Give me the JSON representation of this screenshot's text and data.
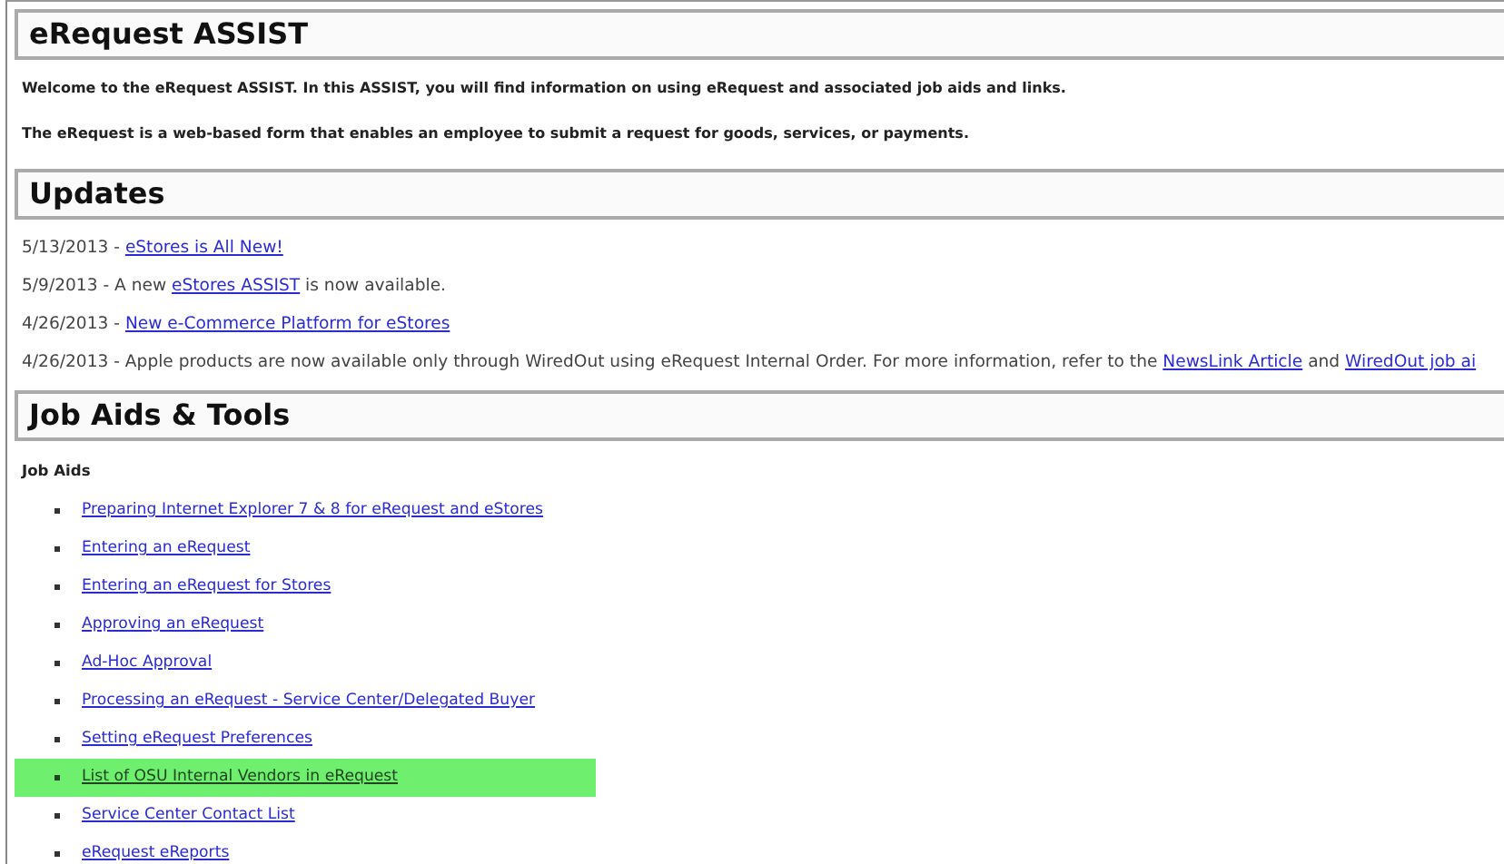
{
  "sections": [
    {
      "heading": "eRequest ASSIST",
      "kind": "intro",
      "paragraphs": [
        "Welcome to the eRequest ASSIST. In this ASSIST, you will find information on using eRequest and associated job aids and links.",
        "The eRequest is a web-based form that enables an employee to submit a request for goods, services, or payments."
      ]
    },
    {
      "heading": "Updates",
      "kind": "updates",
      "items": [
        [
          {
            "text": "5/13/2013 - ",
            "link": false
          },
          {
            "text": "eStores is All New!",
            "link": true
          }
        ],
        [
          {
            "text": "5/9/2013 - A new ",
            "link": false
          },
          {
            "text": "eStores ASSIST",
            "link": true
          },
          {
            "text": " is now available.",
            "link": false
          }
        ],
        [
          {
            "text": "4/26/2013 - ",
            "link": false
          },
          {
            "text": "New e-Commerce Platform for eStores",
            "link": true
          }
        ],
        [
          {
            "text": "4/26/2013 - Apple products are now available only through WiredOut using eRequest Internal Order. For more information, refer to the ",
            "link": false
          },
          {
            "text": "NewsLink Article",
            "link": true
          },
          {
            "text": " and ",
            "link": false
          },
          {
            "text": "WiredOut job ai",
            "link": true
          }
        ]
      ]
    },
    {
      "heading": "Job Aids & Tools",
      "kind": "aids",
      "subheading": "Job Aids",
      "links": [
        {
          "label": "Preparing Internet Explorer 7 & 8 for eRequest and eStores",
          "highlighted": false
        },
        {
          "label": "Entering an eRequest",
          "highlighted": false
        },
        {
          "label": "Entering an eRequest for Stores",
          "highlighted": false
        },
        {
          "label": "Approving an eRequest",
          "highlighted": false
        },
        {
          "label": "Ad-Hoc Approval",
          "highlighted": false
        },
        {
          "label": "Processing an eRequest - Service Center/Delegated Buyer",
          "highlighted": false
        },
        {
          "label": "Setting eRequest Preferences",
          "highlighted": false
        },
        {
          "label": "List of OSU Internal Vendors in eRequest",
          "highlighted": true
        },
        {
          "label": "Service Center Contact List",
          "highlighted": false
        },
        {
          "label": "eRequest eReports",
          "highlighted": false
        }
      ]
    }
  ]
}
